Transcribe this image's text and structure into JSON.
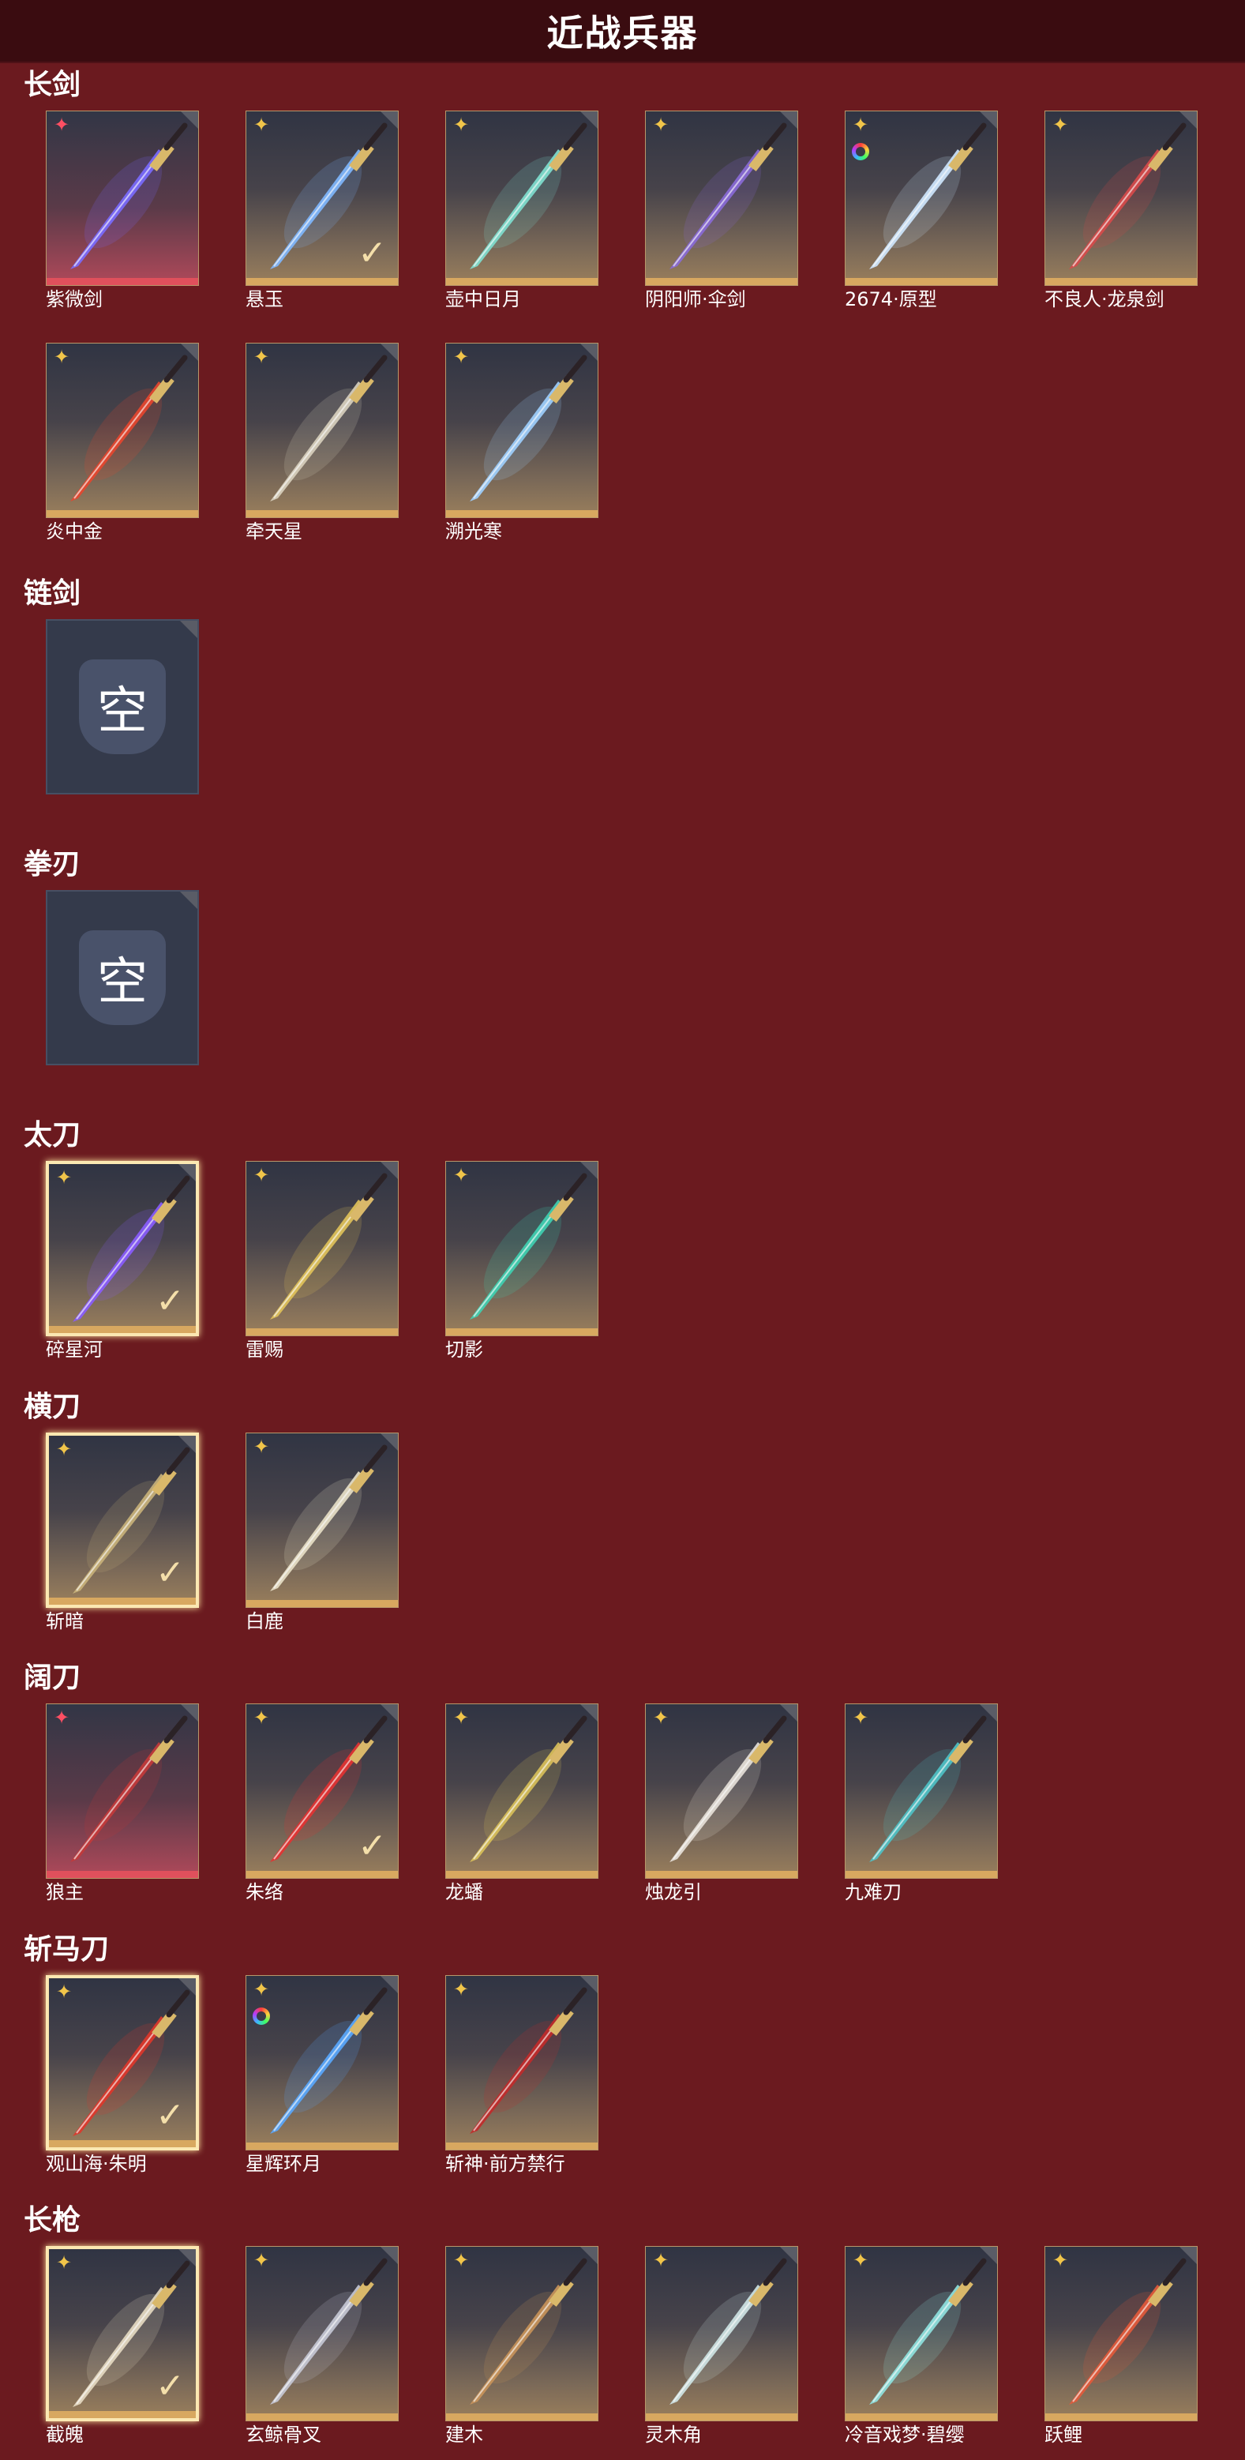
{
  "page": {
    "title": "近战兵器"
  },
  "icons": {
    "badge_gold": "gold-diamond-icon",
    "badge_red": "red-diamond-icon",
    "badge_ring": "rainbow-ring-icon",
    "selected": "checkmark-icon",
    "empty": "empty-slot-icon"
  },
  "colors": {
    "background": "#6b1a1f",
    "header": "#3a0c10",
    "gold": "#d8a860",
    "red": "#e0505c"
  },
  "categories": [
    {
      "title": "长剑",
      "items": [
        {
          "name": "紫微剑",
          "badge": "red",
          "rarity": "red",
          "selected": false,
          "check": false,
          "color": "#7a6bff"
        },
        {
          "name": "悬玉",
          "badge": "gold",
          "rarity": "gold",
          "selected": false,
          "check": true,
          "color": "#7fb8ff"
        },
        {
          "name": "壶中日月",
          "badge": "gold",
          "rarity": "gold",
          "selected": false,
          "check": false,
          "color": "#7fe0d0"
        },
        {
          "name": "阴阳师·伞剑",
          "badge": "gold",
          "rarity": "gold",
          "selected": false,
          "check": false,
          "color": "#8a6ad8"
        },
        {
          "name": "2674·原型",
          "badge": "ring",
          "rarity": "gold",
          "selected": false,
          "check": false,
          "color": "#cfe8ff"
        },
        {
          "name": "不良人·龙泉剑",
          "badge": "gold",
          "rarity": "gold",
          "selected": false,
          "check": false,
          "color": "#d84a4a"
        }
      ]
    },
    {
      "title": "",
      "items": [
        {
          "name": "炎中金",
          "badge": "gold",
          "rarity": "gold",
          "selected": false,
          "check": false,
          "color": "#e8462e"
        },
        {
          "name": "牵天星",
          "badge": "gold",
          "rarity": "gold",
          "selected": false,
          "check": false,
          "color": "#d9d2bf"
        },
        {
          "name": "溯光寒",
          "badge": "gold",
          "rarity": "gold",
          "selected": false,
          "check": false,
          "color": "#9fd0ff"
        }
      ]
    },
    {
      "title": "链剑",
      "items": [
        {
          "name": "",
          "empty": true,
          "glyph": "空"
        }
      ]
    },
    {
      "title": "拳刃",
      "items": [
        {
          "name": "",
          "empty": true,
          "glyph": "空"
        }
      ]
    },
    {
      "title": "太刀",
      "items": [
        {
          "name": "碎星河",
          "badge": "gold",
          "rarity": "gold",
          "selected": true,
          "check": true,
          "color": "#8a5cff"
        },
        {
          "name": "雷赐",
          "badge": "gold",
          "rarity": "gold",
          "selected": false,
          "check": false,
          "color": "#e1c35a"
        },
        {
          "name": "切影",
          "badge": "gold",
          "rarity": "gold",
          "selected": false,
          "check": false,
          "color": "#3fd1b3"
        }
      ]
    },
    {
      "title": "横刀",
      "items": [
        {
          "name": "斩暗",
          "badge": "gold",
          "rarity": "gold",
          "selected": true,
          "check": true,
          "color": "#c9b27a"
        },
        {
          "name": "白鹿",
          "badge": "gold",
          "rarity": "gold",
          "selected": false,
          "check": false,
          "color": "#e9e1c8"
        }
      ]
    },
    {
      "title": "阔刀",
      "items": [
        {
          "name": "狼主",
          "badge": "red",
          "rarity": "red",
          "selected": false,
          "check": false,
          "color": "#c43a3a"
        },
        {
          "name": "朱络",
          "badge": "gold",
          "rarity": "gold",
          "selected": false,
          "check": true,
          "color": "#e63232"
        },
        {
          "name": "龙蟠",
          "badge": "gold",
          "rarity": "gold",
          "selected": false,
          "check": false,
          "color": "#d9c15a"
        },
        {
          "name": "烛龙引",
          "badge": "gold",
          "rarity": "gold",
          "selected": false,
          "check": false,
          "color": "#e8e2da"
        },
        {
          "name": "九难刀",
          "badge": "gold",
          "rarity": "gold",
          "selected": false,
          "check": false,
          "color": "#4fc3c8"
        }
      ]
    },
    {
      "title": "斩马刀",
      "items": [
        {
          "name": "观山海·朱明",
          "badge": "gold",
          "rarity": "gold",
          "selected": true,
          "check": true,
          "color": "#e0362a"
        },
        {
          "name": "星辉环月",
          "badge": "ring",
          "rarity": "gold",
          "selected": false,
          "check": false,
          "color": "#59a8ff"
        },
        {
          "name": "斩神·前方禁行",
          "badge": "gold",
          "rarity": "gold",
          "selected": false,
          "check": false,
          "color": "#c22a2a"
        }
      ]
    },
    {
      "title": "长枪",
      "items": [
        {
          "name": "截魄",
          "badge": "gold",
          "rarity": "gold",
          "selected": true,
          "check": true,
          "color": "#e7dcc3"
        },
        {
          "name": "玄鲸骨叉",
          "badge": "gold",
          "rarity": "gold",
          "selected": false,
          "check": false,
          "color": "#c7c9d6"
        },
        {
          "name": "建木",
          "badge": "gold",
          "rarity": "gold",
          "selected": false,
          "check": false,
          "color": "#c9945a"
        },
        {
          "name": "灵木角",
          "badge": "gold",
          "rarity": "gold",
          "selected": false,
          "check": false,
          "color": "#cfe6e6"
        },
        {
          "name": "冷音戏梦·碧缨",
          "badge": "gold",
          "rarity": "gold",
          "selected": false,
          "check": false,
          "color": "#8fe3e0"
        },
        {
          "name": "跃鲤",
          "badge": "gold",
          "rarity": "gold",
          "selected": false,
          "check": false,
          "color": "#e45a3a"
        }
      ]
    }
  ]
}
